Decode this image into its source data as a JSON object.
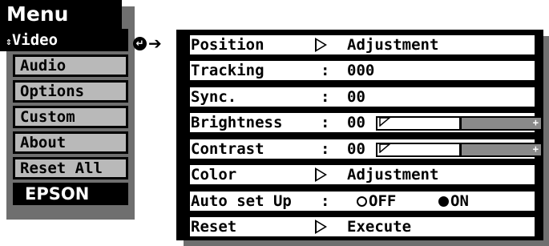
{
  "menu": {
    "title": "Menu",
    "items": [
      {
        "label": "Video",
        "selected": true
      },
      {
        "label": "Audio"
      },
      {
        "label": "Options"
      },
      {
        "label": "Custom"
      },
      {
        "label": "About"
      },
      {
        "label": "Reset All"
      },
      {
        "label": "EPSON",
        "brand": true
      }
    ]
  },
  "indicator": {
    "icon": "enter-icon",
    "arrow": "right-arrow-icon"
  },
  "panel": {
    "rows": [
      {
        "label": "Position",
        "type": "action",
        "value": "Adjustment"
      },
      {
        "label": "Tracking",
        "type": "value",
        "sep": ":",
        "value": "000"
      },
      {
        "label": "Sync.",
        "type": "value",
        "sep": ":",
        "value": "00"
      },
      {
        "label": "Brightness",
        "type": "slider",
        "sep": ":",
        "value": "00",
        "level": 0.5
      },
      {
        "label": "Contrast",
        "type": "slider",
        "sep": ":",
        "value": "00",
        "level": 0.5
      },
      {
        "label": "Color",
        "type": "action",
        "value": "Adjustment"
      },
      {
        "label": "Auto set Up",
        "type": "radio",
        "sep": ":",
        "options": [
          "OFF",
          "ON"
        ],
        "selected": "ON"
      },
      {
        "label": "Reset",
        "type": "action",
        "value": "Execute"
      }
    ]
  },
  "colors": {
    "background": "#ffffff",
    "item_gray": "#b9b9b9",
    "shadow": "#6f6f6f",
    "slider_fill": "#8a8a8a"
  }
}
